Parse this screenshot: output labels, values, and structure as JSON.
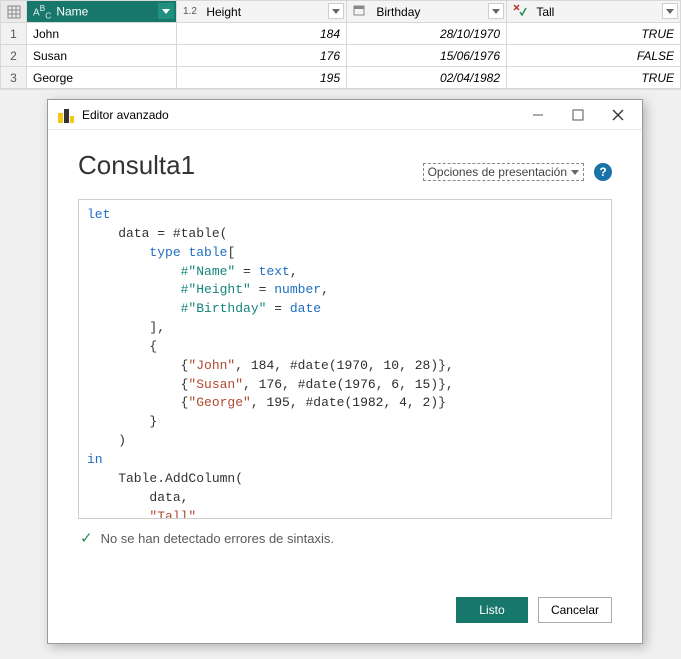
{
  "table": {
    "columns": [
      {
        "label": "Name",
        "type_icon": "ABC",
        "selected": true
      },
      {
        "label": "Height",
        "type_icon": "1.2",
        "selected": false
      },
      {
        "label": "Birthday",
        "type_icon": "cal",
        "selected": false
      },
      {
        "label": "Tall",
        "type_icon": "xy",
        "selected": false
      }
    ],
    "rows": [
      {
        "n": "1",
        "name": "John",
        "height": "184",
        "birthday": "28/10/1970",
        "tall": "TRUE"
      },
      {
        "n": "2",
        "name": "Susan",
        "height": "176",
        "birthday": "15/06/1976",
        "tall": "FALSE"
      },
      {
        "n": "3",
        "name": "George",
        "height": "195",
        "birthday": "02/04/1982",
        "tall": "TRUE"
      }
    ]
  },
  "dialog": {
    "title": "Editor avanzado",
    "heading": "Consulta1",
    "options_label": "Opciones de presentación",
    "status_text": "No se han detectado errores de sintaxis.",
    "ok_label": "Listo",
    "cancel_label": "Cancelar",
    "help": "?"
  }
}
